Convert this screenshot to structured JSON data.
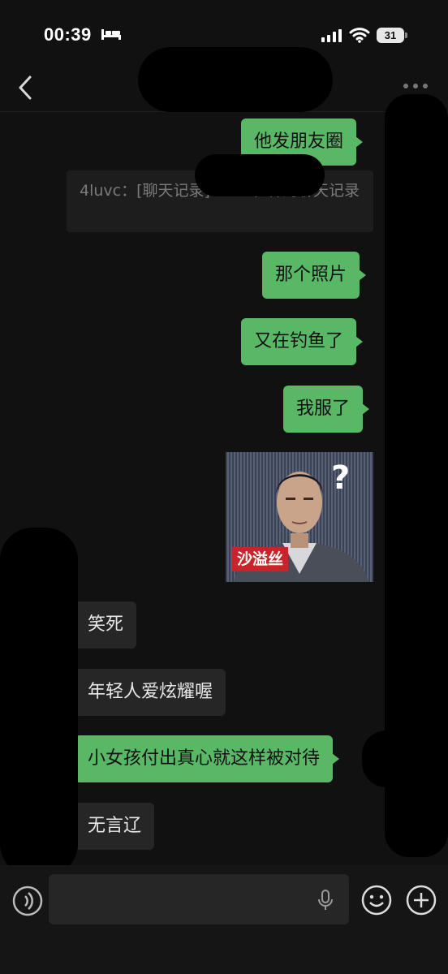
{
  "status_bar": {
    "time": "00:39",
    "battery": "31"
  },
  "icons": {
    "back": "chevron-left-icon",
    "more": "more-dots-icon",
    "sleep": "bed-icon",
    "signal": "signal-icon",
    "wifi": "wifi-icon",
    "voice": "voice-input-icon",
    "mic": "microphone-icon",
    "emoji": "emoji-icon",
    "plus": "plus-icon"
  },
  "messages": [
    {
      "side": "out",
      "text": "他发朋友圈"
    },
    {
      "side": "quote",
      "text": "4luvc：[聊天记录]4luvc和林的聊天记录"
    },
    {
      "side": "out",
      "text": "那个照片"
    },
    {
      "side": "out",
      "text": "又在钓鱼了"
    },
    {
      "side": "out",
      "text": "我服了"
    },
    {
      "side": "sticker",
      "caption": "沙溢丝",
      "mark": "?"
    },
    {
      "side": "in",
      "text": "笑死"
    },
    {
      "side": "in",
      "text": "年轻人爱炫耀喔"
    },
    {
      "side": "out",
      "text": "小女孩付出真心就这样被对待"
    },
    {
      "side": "in",
      "text": "无言辽"
    }
  ],
  "colors": {
    "background": "#111111",
    "outgoing_bubble": "#58b865",
    "incoming_bubble": "#262626",
    "sticker_caption": "#c8242a"
  }
}
